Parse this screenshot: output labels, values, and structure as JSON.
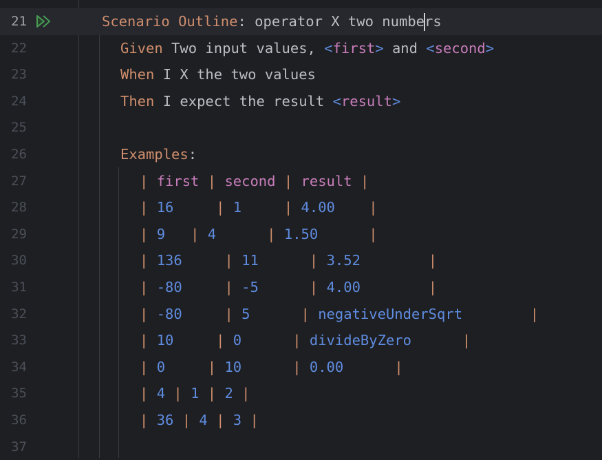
{
  "editor": {
    "run_icon": "run-scenario-double-arrow-icon",
    "accent_run_color": "#499c54",
    "current_line": 21,
    "caret_after": "numbe"
  },
  "lines": [
    {
      "num": "21"
    },
    {
      "num": "22"
    },
    {
      "num": "23"
    },
    {
      "num": "24"
    },
    {
      "num": "25"
    },
    {
      "num": "26"
    },
    {
      "num": "27"
    },
    {
      "num": "28"
    },
    {
      "num": "29"
    },
    {
      "num": "30"
    },
    {
      "num": "31"
    },
    {
      "num": "32"
    },
    {
      "num": "33"
    },
    {
      "num": "34"
    },
    {
      "num": "35"
    },
    {
      "num": "36"
    },
    {
      "num": "37"
    }
  ],
  "scenario": {
    "keyword": "Scenario Outline",
    "colon": ":",
    "title_before_caret": " operator X two numbe",
    "title_after_caret": "rs"
  },
  "steps": {
    "given": {
      "keyword": "Given",
      "text1": " Two input values, ",
      "ph1_open": "<",
      "ph1": "first",
      "ph1_close": ">",
      "text2": " and ",
      "ph2_open": "<",
      "ph2": "second",
      "ph2_close": ">"
    },
    "when": {
      "keyword": "When",
      "text": " I X the two values"
    },
    "then": {
      "keyword": "Then",
      "text": " I expect the result ",
      "ph_open": "<",
      "ph": "result",
      "ph_close": ">"
    }
  },
  "examples": {
    "keyword": "Examples",
    "colon": ":",
    "header": [
      "first",
      "second",
      "result"
    ],
    "rows": [
      {
        "cells": [
          "16",
          "1",
          "4.00"
        ],
        "pads": [
          "     ",
          "     ",
          "    "
        ]
      },
      {
        "cells": [
          "9",
          "4",
          "1.50"
        ],
        "pads": [
          "   ",
          "      ",
          "      "
        ]
      },
      {
        "cells": [
          "136",
          "11",
          "3.52"
        ],
        "pads": [
          "     ",
          "      ",
          "        "
        ]
      },
      {
        "cells": [
          "-80",
          "-5",
          "4.00"
        ],
        "pads": [
          "     ",
          "      ",
          "        "
        ]
      },
      {
        "cells": [
          "-80",
          "5",
          "negativeUnderSqrt"
        ],
        "pads": [
          "     ",
          "      ",
          "        "
        ]
      },
      {
        "cells": [
          "10",
          "0",
          "divideByZero"
        ],
        "pads": [
          "     ",
          "      ",
          "      "
        ]
      },
      {
        "cells": [
          "0",
          "10",
          "0.00"
        ],
        "pads": [
          "     ",
          "      ",
          "      "
        ]
      },
      {
        "cells": [
          "4",
          "1",
          "2"
        ],
        "pads": [
          " ",
          " ",
          " "
        ]
      },
      {
        "cells": [
          "36",
          "4",
          "3"
        ],
        "pads": [
          " ",
          " ",
          " "
        ]
      }
    ]
  }
}
